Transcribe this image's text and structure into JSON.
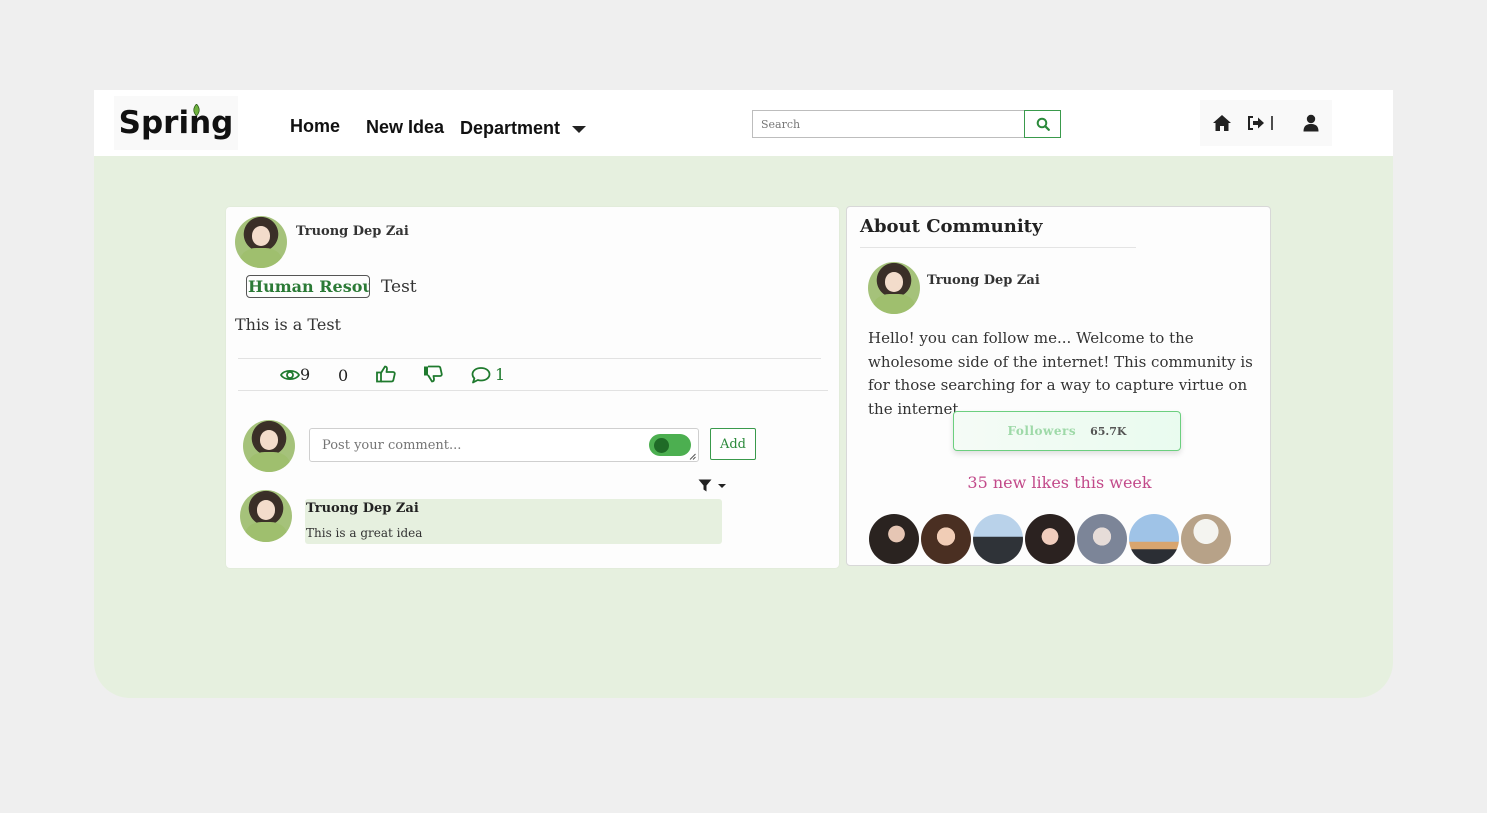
{
  "brand": {
    "name": "Spring"
  },
  "nav": {
    "home": "Home",
    "new_idea": "New Idea",
    "department": "Department"
  },
  "search": {
    "placeholder": "Search"
  },
  "colors": {
    "accent": "#2b8a3b",
    "page_bg": "#e6f0df",
    "likes": "#c24a8a"
  },
  "post": {
    "author": "Truong Dep Zai",
    "department": "Human Resource",
    "title": "Test",
    "body": "This is a Test",
    "stats": {
      "views": "9",
      "score": "0",
      "comments": "1"
    },
    "comment_input": {
      "placeholder": "Post your comment..."
    },
    "add_label": "Add",
    "comments": [
      {
        "author": "Truong Dep Zai",
        "text": "This is a great idea"
      }
    ]
  },
  "about": {
    "title": "About Community",
    "owner": "Truong Dep Zai",
    "description": "Hello! you can follow me... Welcome to the wholesome side of the internet! This community is for those searching for a way to capture virtue on the internet.",
    "followers_label": "Followers",
    "followers_count": "65.7K",
    "likes_text": "35 new likes this week",
    "member_count": 7
  },
  "icons": [
    "search-icon",
    "home-icon",
    "logout-icon",
    "user-icon",
    "eye-icon",
    "thumbs-up-icon",
    "thumbs-down-icon",
    "comment-icon",
    "filter-icon",
    "chevron-down-icon"
  ]
}
